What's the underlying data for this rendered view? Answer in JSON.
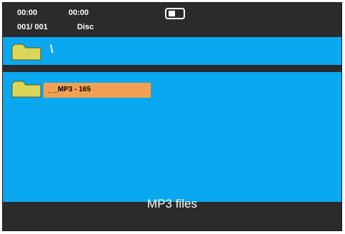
{
  "status": {
    "time_elapsed": "00:00",
    "time_total": "00:00",
    "track_counter": "001/ 001",
    "source": "Disc",
    "icon": "battery-icon"
  },
  "path": {
    "current": "\\",
    "icon": "folder-icon"
  },
  "files": [
    {
      "name": "_ _MP3 - 165",
      "icon": "folder-icon",
      "selected": true
    }
  ],
  "footer": {
    "label": "MP3 files"
  },
  "colors": {
    "panel_blue": "#0aa8f0",
    "bar_dark": "#2b2b2b",
    "selection_orange": "#f2a154",
    "folder_yellow": "#d9d65a"
  }
}
